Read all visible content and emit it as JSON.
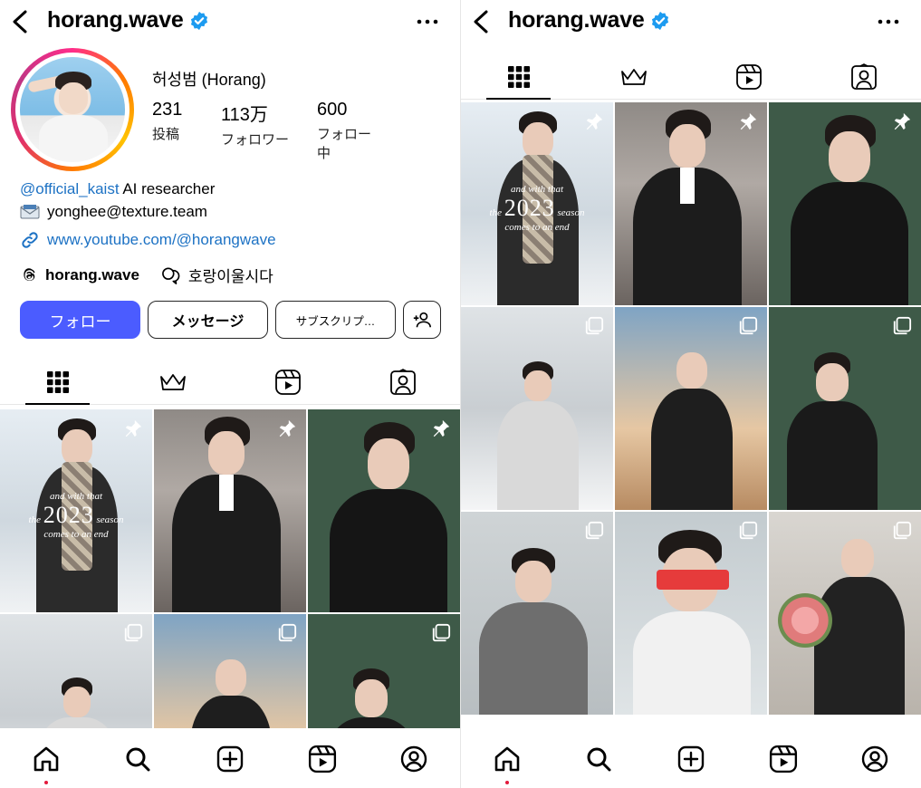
{
  "left": {
    "header": {
      "title": "horang.wave",
      "verified": "verified-badge-icon"
    },
    "profile": {
      "display_name": "허성범 (Horang)",
      "stats": [
        {
          "value": "231",
          "label": "投稿"
        },
        {
          "value": "113万",
          "label": "フォロワー"
        },
        {
          "value": "600",
          "label": "フォロー中"
        }
      ],
      "bio": {
        "mention": "@official_kaist",
        "role": " AI researcher",
        "email": "yonghee@texture.team",
        "link": "www.youtube.com/@horangwave"
      },
      "threads_handle": "horang.wave",
      "tag": "호랑이울시다"
    },
    "buttons": {
      "follow": "フォロー",
      "message": "メッセージ",
      "subscribe": "サブスクリプ…"
    },
    "grid_caption": {
      "line1": "and with that",
      "year": "2023",
      "season": "season",
      "line3": "comes to an end"
    }
  },
  "right": {
    "header": {
      "title": "horang.wave"
    },
    "grid_caption": {
      "line1": "and with that",
      "year": "2023",
      "season": "season",
      "line3": "comes to an end"
    }
  },
  "colors": {
    "accent": "#4b5cff",
    "link": "#1d72c4",
    "verified": "#1d9bf0",
    "notification_dot": "#e3193c"
  }
}
